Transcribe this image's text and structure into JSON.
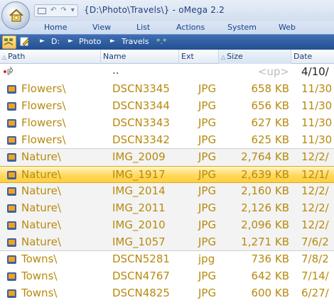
{
  "window": {
    "title": "{D:\\Photo\\Travels\\} - oMega 2.2",
    "quick_access": {
      "back_glyph": "↶",
      "forward_glyph": "↷",
      "dropdown_glyph": "▾"
    }
  },
  "ribbon": {
    "tabs": [
      "Home",
      "View",
      "List",
      "Actions",
      "System",
      "Web"
    ]
  },
  "addressbar": {
    "crumbs": [
      "D:",
      "Photo",
      "Travels",
      "*.*"
    ],
    "separator": "►"
  },
  "columns": {
    "path": "Path",
    "name": "Name",
    "ext": "Ext",
    "size": "Size",
    "date": "Date",
    "sort_glyph": "△"
  },
  "rows": [
    {
      "path": "",
      "name": "..",
      "ext": "",
      "size": "<up>",
      "date": "4/10/"
    },
    {
      "path": "Flowers\\",
      "name": "DSCN3345",
      "ext": "JPG",
      "size": "658 KB",
      "date": "11/30"
    },
    {
      "path": "Flowers\\",
      "name": "DSCN3344",
      "ext": "JPG",
      "size": "656 KB",
      "date": "11/30"
    },
    {
      "path": "Flowers\\",
      "name": "DSCN3343",
      "ext": "JPG",
      "size": "627 KB",
      "date": "11/30"
    },
    {
      "path": "Flowers\\",
      "name": "DSCN3342",
      "ext": "JPG",
      "size": "625 KB",
      "date": "11/30"
    },
    {
      "path": "Nature\\",
      "name": "IMG_2009",
      "ext": "JPG",
      "size": "2,764 KB",
      "date": "12/2/"
    },
    {
      "path": "Nature\\",
      "name": "IMG_1917",
      "ext": "JPG",
      "size": "2,639 KB",
      "date": "12/1/"
    },
    {
      "path": "Nature\\",
      "name": "IMG_2014",
      "ext": "JPG",
      "size": "2,160 KB",
      "date": "12/2/"
    },
    {
      "path": "Nature\\",
      "name": "IMG_2011",
      "ext": "JPG",
      "size": "2,126 KB",
      "date": "12/2/"
    },
    {
      "path": "Nature\\",
      "name": "IMG_2010",
      "ext": "JPG",
      "size": "2,096 KB",
      "date": "12/2/"
    },
    {
      "path": "Nature\\",
      "name": "IMG_1057",
      "ext": "JPG",
      "size": "1,271 KB",
      "date": "7/6/2"
    },
    {
      "path": "Towns\\",
      "name": "DSCN5281",
      "ext": "jpg",
      "size": "736 KB",
      "date": "7/8/2"
    },
    {
      "path": "Towns\\",
      "name": "DSCN4767",
      "ext": "JPG",
      "size": "642 KB",
      "date": "7/14/"
    },
    {
      "path": "Towns\\",
      "name": "DSCN4825",
      "ext": "JPG",
      "size": "600 KB",
      "date": "6/27/"
    }
  ],
  "colors": {
    "file_text": "#b78a0e",
    "selection": "#ffd85c",
    "address_bar": "#2f5c9e"
  }
}
